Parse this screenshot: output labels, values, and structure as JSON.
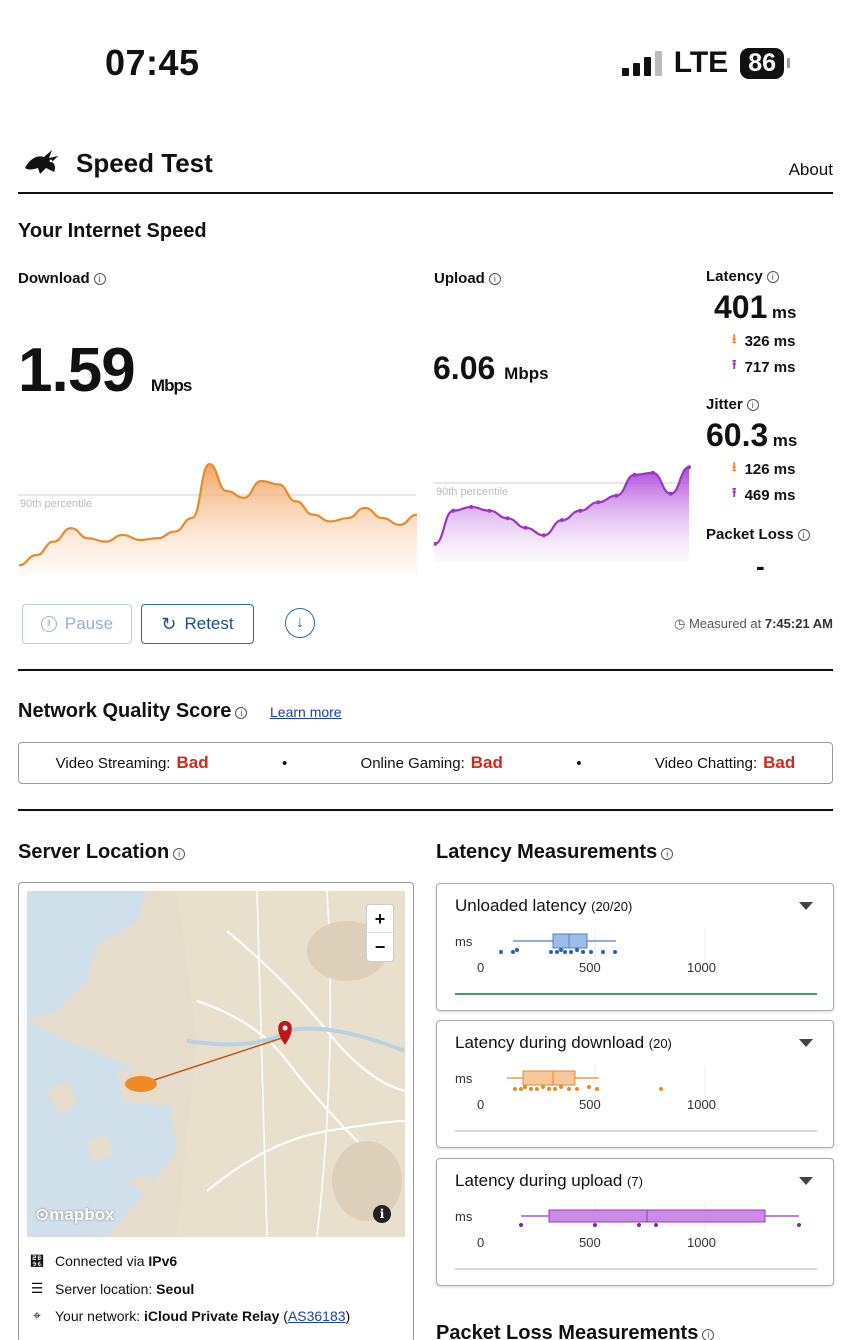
{
  "status_bar": {
    "time": "07:45",
    "network": "LTE",
    "battery": "86"
  },
  "header": {
    "title": "Speed Test",
    "about": "About"
  },
  "speed": {
    "section_title": "Your Internet Speed",
    "download": {
      "label": "Download",
      "value": "1.59",
      "unit": "Mbps",
      "percentile": "90th percentile"
    },
    "upload": {
      "label": "Upload",
      "value": "6.06",
      "unit": "Mbps",
      "percentile": "90th percentile"
    },
    "latency": {
      "label": "Latency",
      "value": "401",
      "unit": "ms",
      "down": "326 ms",
      "up": "717 ms"
    },
    "jitter": {
      "label": "Jitter",
      "value": "60.3",
      "unit": "ms",
      "down": "126 ms",
      "up": "469 ms"
    },
    "packet_loss": {
      "label": "Packet Loss",
      "value": "-"
    }
  },
  "controls": {
    "pause": "Pause",
    "retest": "Retest",
    "measured_prefix": "Measured at",
    "measured_time": "7:45:21 AM"
  },
  "network_quality": {
    "title": "Network Quality Score",
    "learn_more": "Learn more",
    "items": [
      {
        "label": "Video Streaming:",
        "value": "Bad"
      },
      {
        "label": "Online Gaming:",
        "value": "Bad"
      },
      {
        "label": "Video Chatting:",
        "value": "Bad"
      }
    ]
  },
  "server": {
    "title": "Server Location",
    "map_brand": "mapbox",
    "connected_prefix": "Connected via",
    "connected_value": "IPv6",
    "location_prefix": "Server location:",
    "location_value": "Seoul",
    "network_prefix": "Your network:",
    "network_value": "iCloud Private Relay",
    "network_as": "AS36183"
  },
  "latency_measurements": {
    "title": "Latency Measurements",
    "unit": "ms",
    "ticks": [
      "0",
      "500",
      "1000"
    ],
    "cards": [
      {
        "title": "Unloaded latency",
        "count": "(20/20)",
        "color": "#4a7fd0"
      },
      {
        "title": "Latency during download",
        "count": "(20)",
        "color": "#f0a05a"
      },
      {
        "title": "Latency during upload",
        "count": "(7)",
        "color": "#b65cd6"
      }
    ]
  },
  "packet_loss_measurements": {
    "title": "Packet Loss Measurements"
  },
  "chart_data": [
    {
      "type": "area",
      "title": "Download",
      "x": [
        0,
        1,
        2,
        3,
        4,
        5,
        6,
        7,
        8,
        9,
        10,
        11,
        12,
        13,
        14,
        15,
        16,
        17,
        18,
        19,
        20,
        21,
        22,
        23
      ],
      "values": [
        0.2,
        0.5,
        0.9,
        1.3,
        1.0,
        0.9,
        1.1,
        0.95,
        1.0,
        1.2,
        1.6,
        3.2,
        2.4,
        2.2,
        2.7,
        2.6,
        2.1,
        1.7,
        1.5,
        1.6,
        1.9,
        1.6,
        1.4,
        1.7
      ],
      "ylim": [
        0,
        3.5
      ]
    },
    {
      "type": "area",
      "title": "Upload",
      "x": [
        0,
        1,
        2,
        3,
        4,
        5,
        6,
        7,
        8,
        9,
        10,
        11,
        12,
        13,
        14
      ],
      "values": [
        1.5,
        5.0,
        5.4,
        5.0,
        4.2,
        3.2,
        2.4,
        4.0,
        5.0,
        5.9,
        6.6,
        8.8,
        9.0,
        6.8,
        9.6
      ],
      "ylim": [
        0,
        11
      ]
    }
  ]
}
